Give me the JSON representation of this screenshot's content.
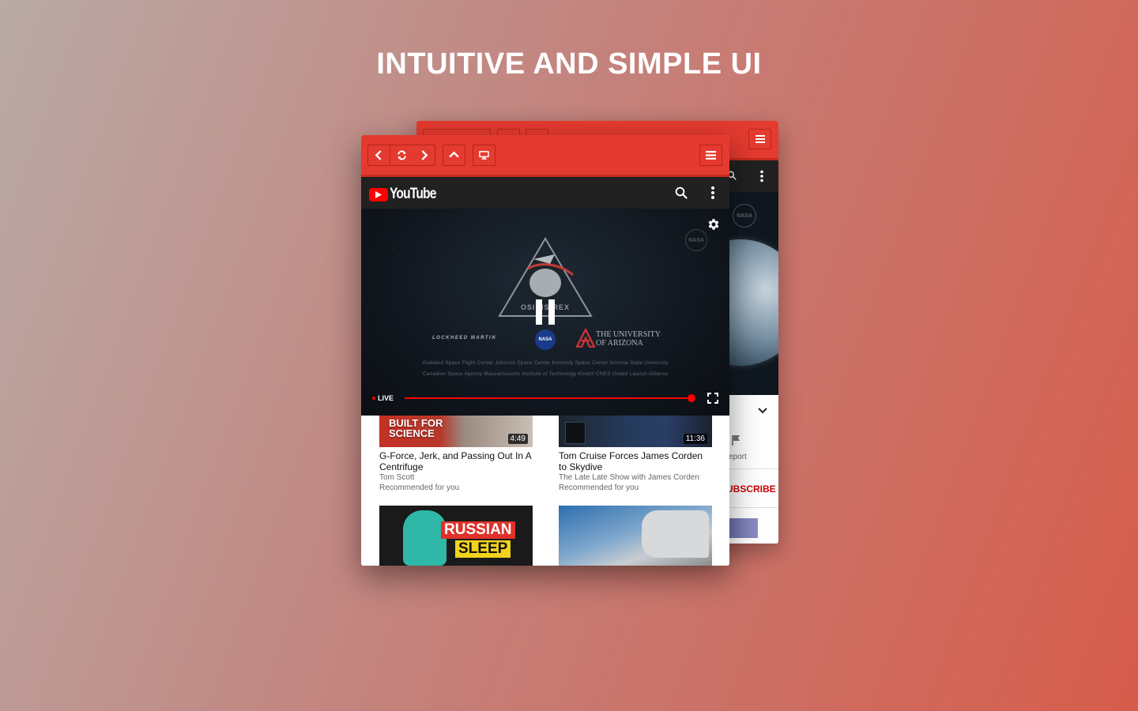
{
  "headline": "INTUITIVE AND SIMPLE UI",
  "back_window": {
    "report_label": "eport",
    "subscribe_label": "UBSCRIBE"
  },
  "app": {
    "name": "YouTube",
    "accent": "#e53a2f",
    "toolbar": {
      "back_icon": "chevron-left-icon",
      "reload_icon": "refresh-icon",
      "forward_icon": "chevron-right-icon",
      "up_icon": "chevron-up-icon",
      "desktop_icon": "desktop-icon",
      "menu_icon": "hamburger-menu-icon"
    }
  },
  "player": {
    "live_label": "LIVE",
    "mission_text": "OSIRIS-REX",
    "sponsor_left": "LOCKHEED MARTIN",
    "sponsor_nasa": "NASA",
    "sponsor_ua_line1": "THE UNIVERSITY",
    "sponsor_ua_line2": "OF ARIZONA",
    "credits_line1": "Goddard Space Flight Center    Johnson Space Center    Kennedy Space Center    Arizona State University",
    "credits_line2": "Canadian Space Agency    Massachusetts Institute of Technology    KinetX    CNES    United Launch Alliance",
    "progress_fraction": 0.98
  },
  "feed": {
    "videos": [
      {
        "title": "G-Force, Jerk, and Passing Out In A Centrifuge",
        "channel": "Tom Scott",
        "note": "Recommended for you",
        "duration": "4:49",
        "thumb_text_1": "BUILT FOR",
        "thumb_text_2": "SCIENCE"
      },
      {
        "title": "Tom Cruise Forces James Corden to Skydive",
        "channel": "The Late Late Show with James Corden",
        "note": "Recommended for you",
        "duration": "11:36"
      },
      {
        "thumb_text_1": "RUSSIAN",
        "thumb_text_2": "SLEEP"
      },
      {}
    ]
  }
}
